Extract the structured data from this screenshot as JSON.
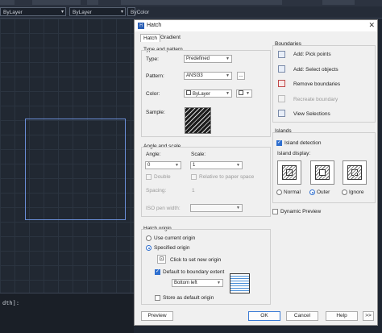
{
  "cad": {
    "layer1": "ByLayer",
    "layer2": "ByLayer",
    "layer3": "ByColor",
    "command_text": "dth]:"
  },
  "dialog": {
    "title": "Hatch",
    "tabs": [
      "Hatch",
      "Gradient"
    ],
    "type_pattern": {
      "title": "Type and pattern",
      "type_label": "Type:",
      "type_value": "Predefined",
      "pattern_label": "Pattern:",
      "pattern_value": "ANSI33",
      "pattern_browse": "...",
      "color_label": "Color:",
      "color_value": "ByLayer",
      "sample_label": "Sample:"
    },
    "angle_scale": {
      "title": "Angle and scale",
      "angle_label": "Angle:",
      "angle_value": "0",
      "scale_label": "Scale:",
      "scale_value": "1",
      "double_label": "Double",
      "relative_label": "Relative to paper space",
      "spacing_label": "Spacing:",
      "spacing_value": "1",
      "iso_label": "ISO pen width:"
    },
    "origin": {
      "title": "Hatch origin",
      "current_label": "Use current origin",
      "specified_label": "Specified origin",
      "click_label": "Click to set new origin",
      "default_label": "Default to boundary extent",
      "position_value": "Bottom left",
      "store_label": "Store as default origin"
    },
    "boundaries": {
      "title": "Boundaries",
      "pick_points": "Add: Pick points",
      "select_objects": "Add: Select objects",
      "remove": "Remove boundaries",
      "recreate": "Recreate boundary",
      "view": "View Selections"
    },
    "islands": {
      "title": "Islands",
      "detection_label": "Island detection",
      "display_label": "Island display:",
      "normal": "Normal",
      "outer": "Outer",
      "ignore": "Ignore"
    },
    "dynamic_preview": "Dynamic Preview",
    "buttons": {
      "preview": "Preview",
      "ok": "OK",
      "cancel": "Cancel",
      "help": "Help",
      "more": ">>"
    }
  }
}
